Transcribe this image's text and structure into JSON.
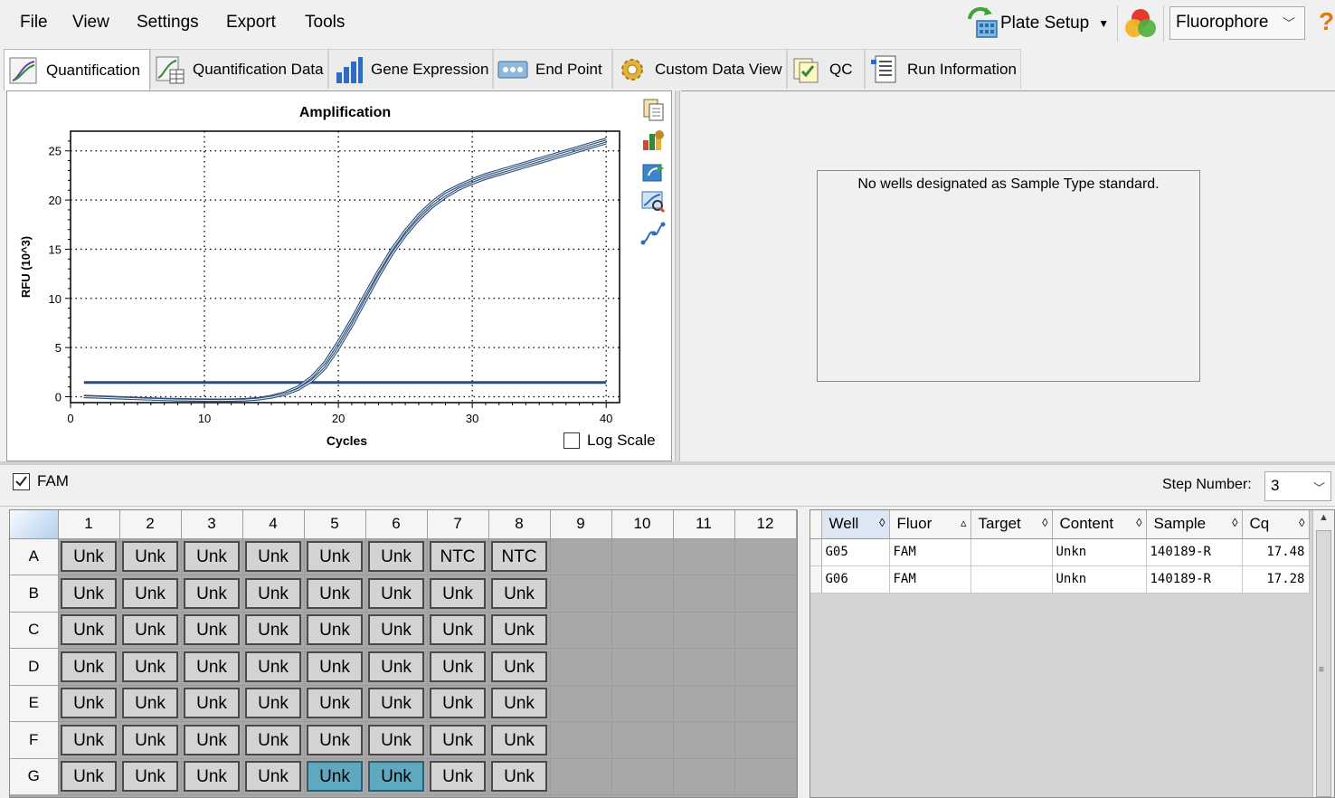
{
  "menu": [
    "File",
    "View",
    "Settings",
    "Export",
    "Tools"
  ],
  "toolbar": {
    "plate_setup_label": "Plate Setup",
    "fluorophore_value": "Fluorophore"
  },
  "tabs": [
    {
      "label": "Quantification",
      "active": true
    },
    {
      "label": "Quantification Data",
      "active": false
    },
    {
      "label": "Gene Expression",
      "active": false
    },
    {
      "label": "End Point",
      "active": false
    },
    {
      "label": "Custom Data View",
      "active": false
    },
    {
      "label": "QC",
      "active": false
    },
    {
      "label": "Run Information",
      "active": false
    }
  ],
  "amplification": {
    "log_scale_label": "Log Scale",
    "log_scale_checked": false
  },
  "chart_data": {
    "type": "line",
    "title": "Amplification",
    "xlabel": "Cycles",
    "ylabel": "RFU (10^3)",
    "xlim": [
      0,
      41
    ],
    "ylim": [
      -0.6,
      27
    ],
    "xticks": [
      0,
      10,
      20,
      30,
      40
    ],
    "yticks": [
      0,
      5,
      10,
      15,
      20,
      25
    ],
    "grid": true,
    "threshold": 1.45,
    "series": [
      {
        "color": "#2f4f7a",
        "x": [
          1,
          2,
          3,
          4,
          5,
          6,
          7,
          8,
          9,
          10,
          11,
          12,
          13,
          14,
          15,
          16,
          17,
          18,
          19,
          20,
          21,
          22,
          23,
          24,
          25,
          26,
          27,
          28,
          29,
          30,
          31,
          32,
          33,
          34,
          35,
          36,
          37,
          38,
          39,
          40
        ],
        "values": [
          0.05,
          0.0,
          -0.05,
          -0.1,
          -0.15,
          -0.2,
          -0.25,
          -0.28,
          -0.3,
          -0.32,
          -0.33,
          -0.32,
          -0.28,
          -0.18,
          0.05,
          0.4,
          1.0,
          2.0,
          3.5,
          5.6,
          7.9,
          10.4,
          12.8,
          15.0,
          16.9,
          18.5,
          19.8,
          20.8,
          21.5,
          22.1,
          22.6,
          23.0,
          23.4,
          23.8,
          24.2,
          24.6,
          25.0,
          25.4,
          25.8,
          26.2
        ]
      },
      {
        "color": "#2f4f7a",
        "x": [
          1,
          2,
          3,
          4,
          5,
          6,
          7,
          8,
          9,
          10,
          11,
          12,
          13,
          14,
          15,
          16,
          17,
          18,
          19,
          20,
          21,
          22,
          23,
          24,
          25,
          26,
          27,
          28,
          29,
          30,
          31,
          32,
          33,
          34,
          35,
          36,
          37,
          38,
          39,
          40
        ],
        "values": [
          0.0,
          -0.05,
          -0.1,
          -0.15,
          -0.2,
          -0.25,
          -0.3,
          -0.33,
          -0.35,
          -0.37,
          -0.38,
          -0.37,
          -0.33,
          -0.24,
          -0.05,
          0.25,
          0.75,
          1.6,
          2.9,
          4.9,
          7.2,
          9.7,
          12.2,
          14.5,
          16.4,
          18.0,
          19.3,
          20.3,
          21.1,
          21.7,
          22.2,
          22.6,
          23.0,
          23.4,
          23.8,
          24.2,
          24.6,
          25.0,
          25.4,
          25.8
        ]
      }
    ]
  },
  "standard_curve": {
    "message": "No wells designated as Sample Type standard."
  },
  "fam_bar": {
    "fluor_label": "FAM",
    "fluor_checked": true,
    "step_label": "Step Number:",
    "step_value": "3"
  },
  "plate": {
    "columns": [
      "1",
      "2",
      "3",
      "4",
      "5",
      "6",
      "7",
      "8",
      "9",
      "10",
      "11",
      "12"
    ],
    "rows": [
      {
        "label": "A",
        "wells": [
          "Unk",
          "Unk",
          "Unk",
          "Unk",
          "Unk",
          "Unk",
          "NTC",
          "NTC"
        ]
      },
      {
        "label": "B",
        "wells": [
          "Unk",
          "Unk",
          "Unk",
          "Unk",
          "Unk",
          "Unk",
          "Unk",
          "Unk"
        ]
      },
      {
        "label": "C",
        "wells": [
          "Unk",
          "Unk",
          "Unk",
          "Unk",
          "Unk",
          "Unk",
          "Unk",
          "Unk"
        ]
      },
      {
        "label": "D",
        "wells": [
          "Unk",
          "Unk",
          "Unk",
          "Unk",
          "Unk",
          "Unk",
          "Unk",
          "Unk"
        ]
      },
      {
        "label": "E",
        "wells": [
          "Unk",
          "Unk",
          "Unk",
          "Unk",
          "Unk",
          "Unk",
          "Unk",
          "Unk"
        ]
      },
      {
        "label": "F",
        "wells": [
          "Unk",
          "Unk",
          "Unk",
          "Unk",
          "Unk",
          "Unk",
          "Unk",
          "Unk"
        ]
      },
      {
        "label": "G",
        "wells": [
          "Unk",
          "Unk",
          "Unk",
          "Unk",
          "Unk",
          "Unk",
          "Unk",
          "Unk"
        ],
        "selected": [
          5,
          6
        ]
      }
    ]
  },
  "results": {
    "headers": [
      "Well",
      "Fluor",
      "Target",
      "Content",
      "Sample",
      "Cq"
    ],
    "rows": [
      [
        "G05",
        "FAM",
        "",
        "Unkn",
        "140189-R",
        "17.48"
      ],
      [
        "G06",
        "FAM",
        "",
        "Unkn",
        "140189-R",
        "17.28"
      ]
    ]
  },
  "colors": {
    "selected_well": "#5fa8bf",
    "curve": "#2f4f7a",
    "threshold": "#1f4e8a"
  }
}
